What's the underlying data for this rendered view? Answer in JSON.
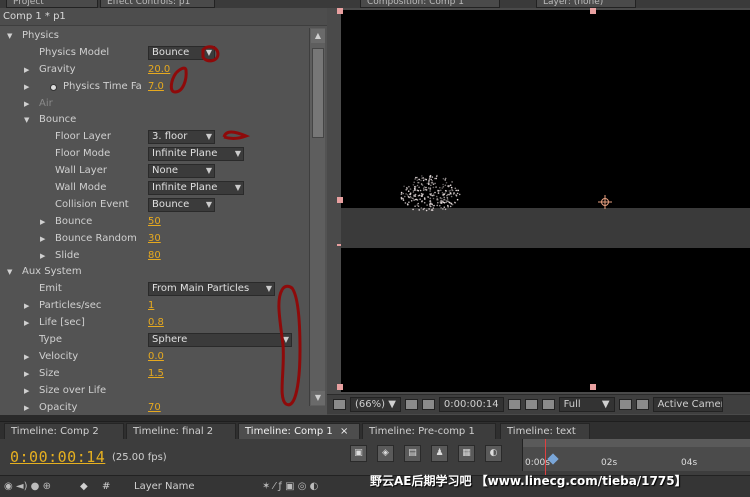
{
  "top_tabs": [
    "Project",
    "Effect Controls: p1",
    "Composition: Comp 1",
    "Layer: (none)"
  ],
  "effect_controls": {
    "header": "Comp 1 * p1",
    "rows": [
      {
        "indent": 1,
        "twirl": "open",
        "label": "Physics"
      },
      {
        "indent": 2,
        "twirl": "none",
        "label": "Physics Model",
        "select": "Bounce"
      },
      {
        "indent": 2,
        "twirl": "closed",
        "label": "Gravity",
        "value": "20.0"
      },
      {
        "indent": 2,
        "twirl": "closed",
        "label": "Physics Time Fa",
        "value": "7.0",
        "stopwatch": true
      },
      {
        "indent": 2,
        "twirl": "closed",
        "label": "Air",
        "dim": true
      },
      {
        "indent": 2,
        "twirl": "open",
        "label": "Bounce"
      },
      {
        "indent": 3,
        "twirl": "none",
        "label": "Floor Layer",
        "select": "3. floor"
      },
      {
        "indent": 3,
        "twirl": "none",
        "label": "Floor Mode",
        "select": "Infinite Plane"
      },
      {
        "indent": 3,
        "twirl": "none",
        "label": "Wall Layer",
        "select": "None"
      },
      {
        "indent": 3,
        "twirl": "none",
        "label": "Wall Mode",
        "select": "Infinite Plane"
      },
      {
        "indent": 3,
        "twirl": "none",
        "label": "Collision Event",
        "select": "Bounce"
      },
      {
        "indent": 3,
        "twirl": "closed",
        "label": "Bounce",
        "value": "50"
      },
      {
        "indent": 3,
        "twirl": "closed",
        "label": "Bounce Random",
        "value": "30"
      },
      {
        "indent": 3,
        "twirl": "closed",
        "label": "Slide",
        "value": "80"
      },
      {
        "indent": 1,
        "twirl": "open",
        "label": "Aux System"
      },
      {
        "indent": 2,
        "twirl": "none",
        "label": "Emit",
        "select": "From Main Particles"
      },
      {
        "indent": 2,
        "twirl": "closed",
        "label": "Particles/sec",
        "value": "1"
      },
      {
        "indent": 2,
        "twirl": "closed",
        "label": "Life [sec]",
        "value": "0.8"
      },
      {
        "indent": 2,
        "twirl": "none",
        "label": "Type",
        "select": "Sphere"
      },
      {
        "indent": 2,
        "twirl": "closed",
        "label": "Velocity",
        "value": "0.0"
      },
      {
        "indent": 2,
        "twirl": "closed",
        "label": "Size",
        "value": "1.5"
      },
      {
        "indent": 2,
        "twirl": "closed",
        "label": "Size over Life"
      },
      {
        "indent": 2,
        "twirl": "closed",
        "label": "Opacity",
        "value": "70"
      }
    ]
  },
  "viewer_bar": {
    "zoom": "(66%)",
    "timecode": "0:00:00:14",
    "resolution": "Full",
    "camera": "Active Camera"
  },
  "timeline_tabs": [
    "Timeline: Comp 2",
    "Timeline: final 2",
    "Timeline: Comp 1",
    "Timeline: Pre-comp 1",
    "Timeline: text"
  ],
  "active_timeline_tab": 2,
  "timeline": {
    "timecode": "0:00:00:14",
    "fps": "(25.00 fps)",
    "ruler_labels": [
      "0:00s",
      "02s",
      "04s"
    ],
    "col_number": "#",
    "col_layer_name": "Layer Name",
    "watermark": "野云AE后期学习吧 【www.linecg.com/tieba/1775】"
  },
  "colors": {
    "value_orange": "#e6a91f",
    "annotation_red": "#8e0a0a",
    "playhead": "#e04040"
  }
}
